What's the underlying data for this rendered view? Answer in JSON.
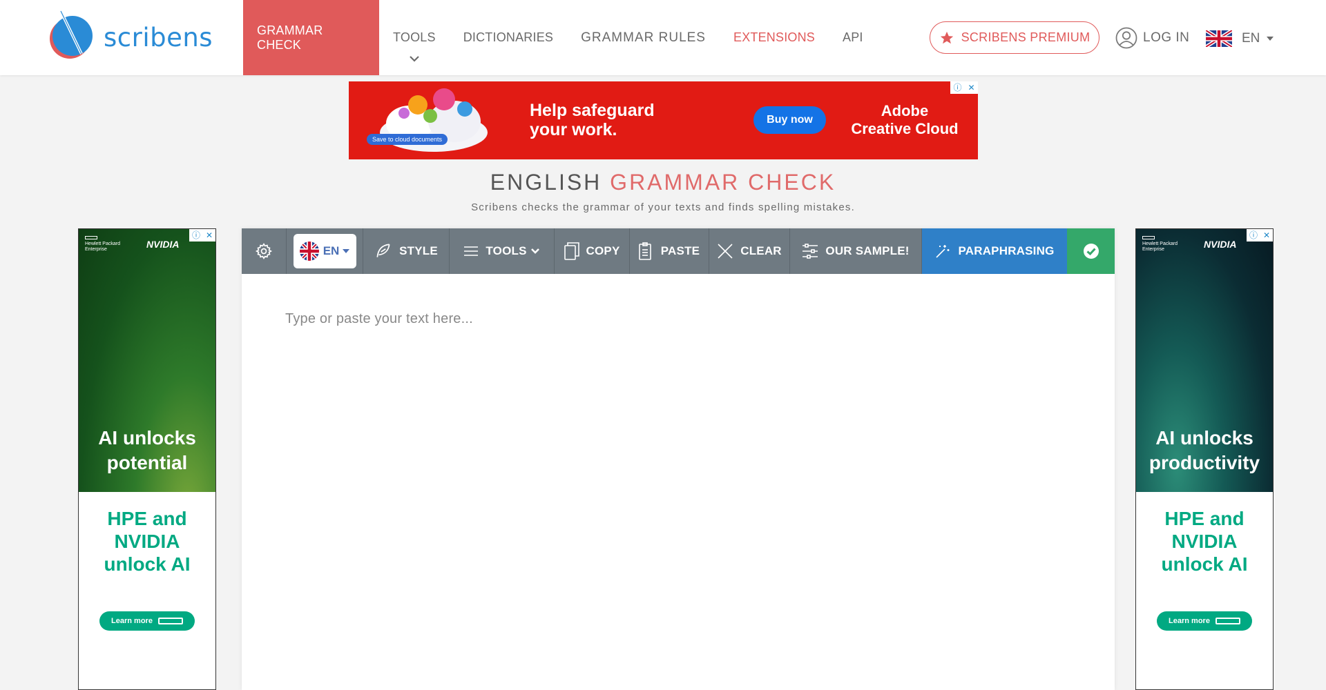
{
  "brand": {
    "name": "scribens"
  },
  "nav": {
    "items": [
      {
        "label": "GRAMMAR CHECK"
      },
      {
        "label": "TOOLS"
      },
      {
        "label": "DICTIONARIES"
      },
      {
        "label": "GRAMMAR RULES"
      },
      {
        "label": "EXTENSIONS"
      },
      {
        "label": "API"
      }
    ],
    "premium_label": "SCRIBENS PREMIUM",
    "login_label": "LOG IN",
    "language": "EN"
  },
  "top_ad": {
    "headline_line1": "Help safeguard",
    "headline_line2": "your work.",
    "cta": "Buy now",
    "brand_line1": "Adobe",
    "brand_line2": "Creative Cloud",
    "tag": "Save to cloud documents"
  },
  "page": {
    "title_part1": "ENGLISH",
    "title_part2": "GRAMMAR CHECK",
    "subtitle": "Scribens checks the grammar of your texts and finds spelling mistakes."
  },
  "side_ads": {
    "left": {
      "hpe_line1": "Hewlett Packard",
      "hpe_line2": "Enterprise",
      "nvidia": "NVIDIA",
      "big_line1": "AI unlocks",
      "big_line2": "potential",
      "teal_line1": "HPE and",
      "teal_line2": "NVIDIA",
      "teal_line3": "unlock AI",
      "cta": "Learn more"
    },
    "right": {
      "hpe_line1": "Hewlett Packard",
      "hpe_line2": "Enterprise",
      "nvidia": "NVIDIA",
      "big_line1": "AI unlocks",
      "big_line2": "productivity",
      "teal_line1": "HPE and",
      "teal_line2": "NVIDIA",
      "teal_line3": "unlock AI",
      "cta": "Learn more"
    }
  },
  "toolbar": {
    "language": "EN",
    "style": "STYLE",
    "tools": "TOOLS",
    "copy": "COPY",
    "paste": "PASTE",
    "clear": "CLEAR",
    "sample": "OUR SAMPLE!",
    "paraphrasing": "PARAPHRASING"
  },
  "editor": {
    "placeholder": "Type or paste your text here..."
  },
  "colors": {
    "accent_red": "#e05a5a",
    "toolbar_gray": "#6f7a82",
    "paraphrase_blue": "#2f80c8",
    "check_green": "#34a86a",
    "logo_blue": "#2a8bd6"
  },
  "icons": [
    "scribens-logo",
    "chevron-down-icon",
    "star-icon",
    "user-icon",
    "uk-flag-icon",
    "caret-down-icon",
    "gear-icon",
    "feather-icon",
    "menu-icon",
    "copy-icon",
    "paste-icon",
    "close-icon",
    "sliders-icon",
    "magic-wand-icon",
    "check-circle-icon"
  ]
}
